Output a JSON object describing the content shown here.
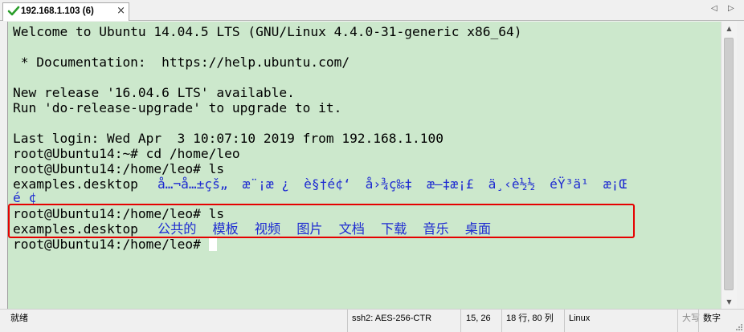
{
  "tab": {
    "title": "192.168.1.103 (6)",
    "status_icon": "green-check-icon",
    "close_glyph": "×"
  },
  "nav": {
    "left": "◁",
    "right": "▷"
  },
  "terminal": {
    "background": "#cce8cc",
    "directory_color": "#1e2bd1",
    "highlight_color": "#e60000",
    "lines": [
      "Welcome to Ubuntu 14.04.5 LTS (GNU/Linux 4.4.0-31-generic x86_64)",
      "",
      " * Documentation:  https://help.ubuntu.com/",
      "",
      "New release '16.04.6 LTS' available.",
      "Run 'do-release-upgrade' to upgrade to it.",
      "",
      "Last login: Wed Apr  3 10:07:10 2019 from 192.168.1.100",
      "root@Ubuntu14:~# cd /home/leo",
      "root@Ubuntu14:/home/leo# ls"
    ],
    "ls1": {
      "file": "examples.desktop",
      "garbled_dirs": [
        "å…¬å…±çš„",
        "æ¨¡æ ¿",
        "è§†é¢‘",
        "å›¾ç‰‡",
        "æ–‡æ¡£",
        "ä¸‹è½½",
        "éŸ³ä¹",
        "æ¡Œ"
      ],
      "wrap": "é ¢"
    },
    "prompt_ls2": "root@Ubuntu14:/home/leo# ls",
    "ls2": {
      "file": "examples.desktop",
      "dirs": [
        "公共的",
        "模板",
        "视频",
        "图片",
        "文档",
        "下载",
        "音乐",
        "桌面"
      ]
    },
    "final_prompt": "root@Ubuntu14:/home/leo# "
  },
  "statusbar": {
    "ready": "就绪",
    "connection": "ssh2: AES-256-CTR",
    "cursor_pos": "15,  26",
    "rows_cols": "18 行, 80 列",
    "term_type": "Linux",
    "caps": "大写",
    "num": "数字"
  }
}
